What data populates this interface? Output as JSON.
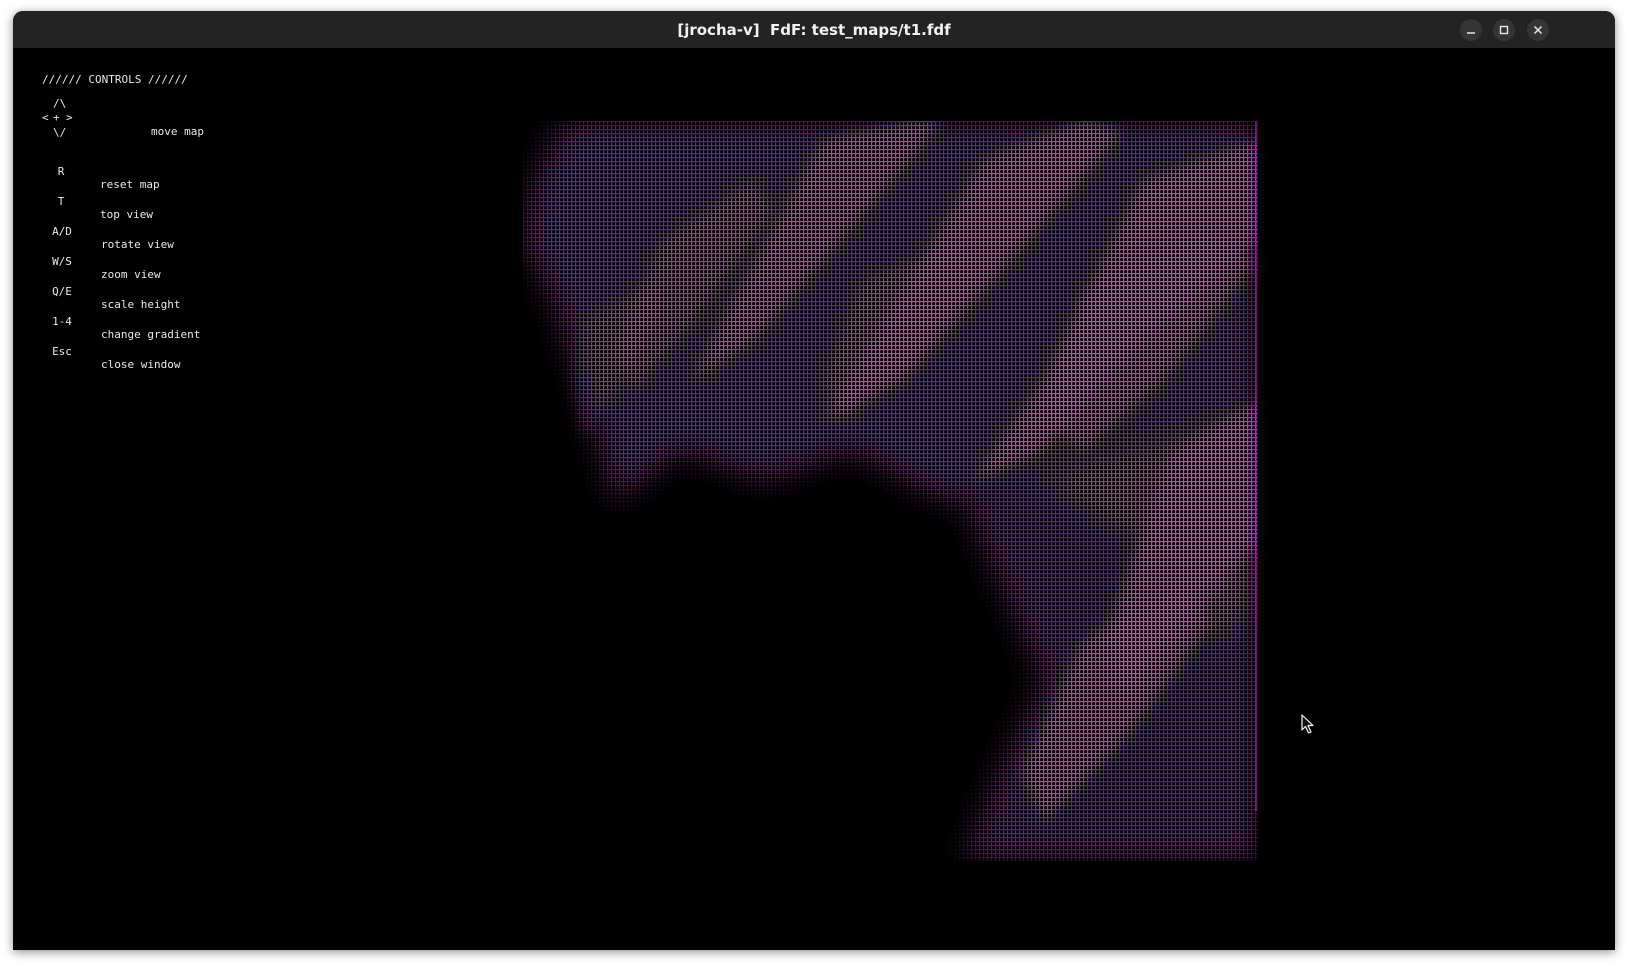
{
  "window": {
    "title": "[jrocha-v]  FdF: test_maps/t1.fdf",
    "buttons": [
      {
        "name": "minimize",
        "icon": "minimize-icon"
      },
      {
        "name": "maximize",
        "icon": "maximize-icon"
      },
      {
        "name": "close",
        "icon": "close-icon"
      }
    ]
  },
  "controls": {
    "header": "////// CONTROLS //////",
    "arrow_pad": {
      "up": "/\\",
      "left": "<",
      "center": "+",
      "right": ">",
      "down": "\\/"
    },
    "items": [
      {
        "key": "",
        "label": "move map"
      },
      {
        "key": "R",
        "label": "reset map"
      },
      {
        "key": "T",
        "label": "top view"
      },
      {
        "key": "A/D",
        "label": "rotate view"
      },
      {
        "key": "W/S",
        "label": "zoom view"
      },
      {
        "key": "Q/E",
        "label": "scale height"
      },
      {
        "key": "1-4",
        "label": "change gradient"
      },
      {
        "key": "Esc",
        "label": "close window"
      }
    ]
  },
  "map": {
    "file": "test_maps/t1.fdf",
    "gradient_color": "#d21ed2",
    "background": "#000000"
  },
  "colors": {
    "titlebar": "#232323",
    "title_text": "#f2f2f2",
    "text": "#e8e8e8"
  }
}
